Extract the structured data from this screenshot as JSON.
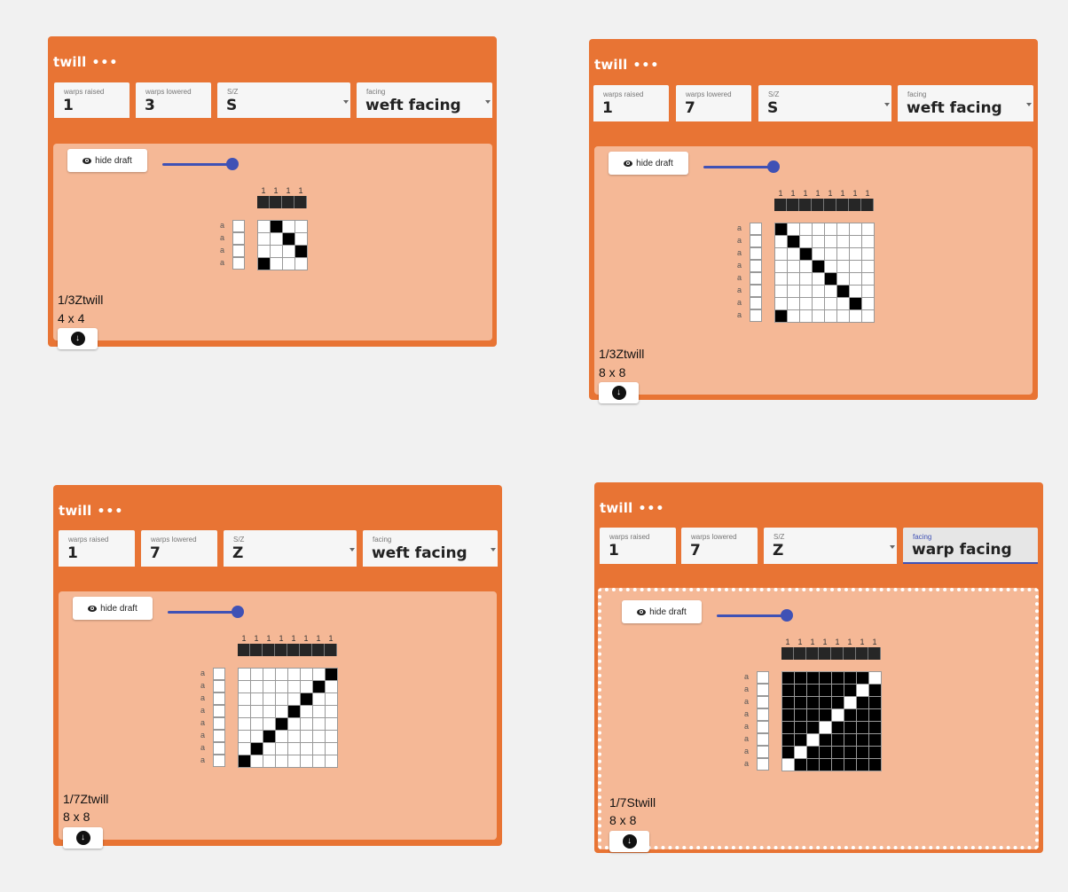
{
  "cards": [
    {
      "title": "twill",
      "menu": "•••",
      "warps_raised_label": "warps raised",
      "warps_raised": "1",
      "warps_lowered_label": "warps lowered",
      "warps_lowered": "3",
      "sz_label": "S/Z",
      "sz": "S",
      "facing_label": "facing",
      "facing": "weft facing",
      "hide_label": "hide draft",
      "col_labels": [
        "1",
        "1",
        "1",
        "1"
      ],
      "row_labels": [
        "a",
        "a",
        "a",
        "a"
      ],
      "grid": [
        "0100",
        "0010",
        "0001",
        "1000"
      ],
      "name": "1/3Ztwill",
      "size": "4 x 4"
    },
    {
      "title": "twill",
      "menu": "•••",
      "warps_raised_label": "warps raised",
      "warps_raised": "1",
      "warps_lowered_label": "warps lowered",
      "warps_lowered": "7",
      "sz_label": "S/Z",
      "sz": "S",
      "facing_label": "facing",
      "facing": "weft facing",
      "hide_label": "hide draft",
      "col_labels": [
        "1",
        "1",
        "1",
        "1",
        "1",
        "1",
        "1",
        "1"
      ],
      "row_labels": [
        "a",
        "a",
        "a",
        "a",
        "a",
        "a",
        "a",
        "a"
      ],
      "grid": [
        "10000000",
        "01000000",
        "00100000",
        "00010000",
        "00001000",
        "00000100",
        "00000010",
        "10000000"
      ],
      "name": "1/3Ztwill",
      "size": "8 x 8"
    },
    {
      "title": "twill",
      "menu": "•••",
      "warps_raised_label": "warps raised",
      "warps_raised": "1",
      "warps_lowered_label": "warps lowered",
      "warps_lowered": "7",
      "sz_label": "S/Z",
      "sz": "Z",
      "facing_label": "facing",
      "facing": "weft facing",
      "hide_label": "hide draft",
      "col_labels": [
        "1",
        "1",
        "1",
        "1",
        "1",
        "1",
        "1",
        "1"
      ],
      "row_labels": [
        "a",
        "a",
        "a",
        "a",
        "a",
        "a",
        "a",
        "a"
      ],
      "grid": [
        "00000001",
        "00000010",
        "00000100",
        "00001000",
        "00010000",
        "00100000",
        "01000000",
        "10000000"
      ],
      "name": "1/7Ztwill",
      "size": "8 x 8"
    },
    {
      "title": "twill",
      "menu": "•••",
      "warps_raised_label": "warps raised",
      "warps_raised": "1",
      "warps_lowered_label": "warps lowered",
      "warps_lowered": "7",
      "sz_label": "S/Z",
      "sz": "Z",
      "facing_label": "facing",
      "facing": "warp facing",
      "hide_label": "hide draft",
      "col_labels": [
        "1",
        "1",
        "1",
        "1",
        "1",
        "1",
        "1",
        "1"
      ],
      "row_labels": [
        "a",
        "a",
        "a",
        "a",
        "a",
        "a",
        "a",
        "a"
      ],
      "grid": [
        "11111110",
        "11111101",
        "11111011",
        "11110111",
        "11101111",
        "11011111",
        "10111111",
        "01111111"
      ],
      "name": "1/7Stwill",
      "size": "8 x 8"
    }
  ]
}
